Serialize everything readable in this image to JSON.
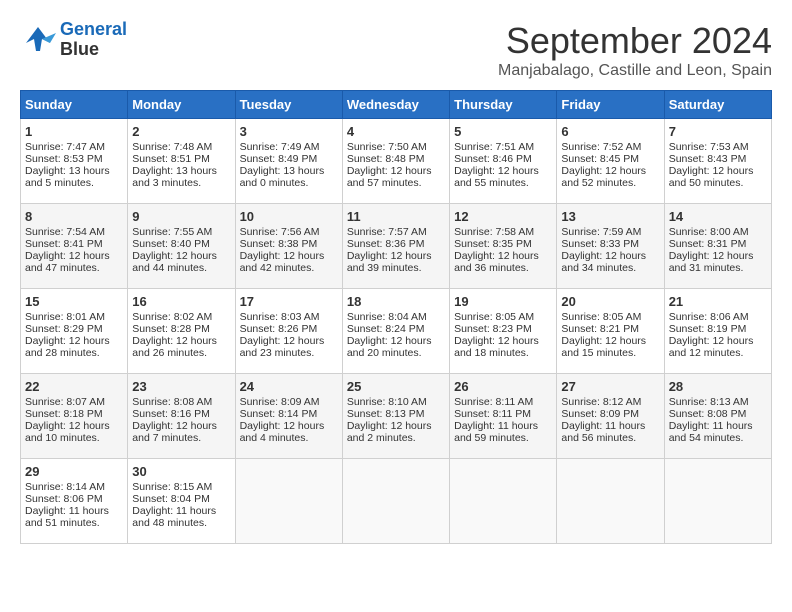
{
  "header": {
    "logo_line1": "General",
    "logo_line2": "Blue",
    "month": "September 2024",
    "location": "Manjabalago, Castille and Leon, Spain"
  },
  "days_of_week": [
    "Sunday",
    "Monday",
    "Tuesday",
    "Wednesday",
    "Thursday",
    "Friday",
    "Saturday"
  ],
  "weeks": [
    [
      {
        "day": "1",
        "sunrise": "7:47 AM",
        "sunset": "8:53 PM",
        "daylight": "13 hours and 5 minutes."
      },
      {
        "day": "2",
        "sunrise": "7:48 AM",
        "sunset": "8:51 PM",
        "daylight": "13 hours and 3 minutes."
      },
      {
        "day": "3",
        "sunrise": "7:49 AM",
        "sunset": "8:49 PM",
        "daylight": "13 hours and 0 minutes."
      },
      {
        "day": "4",
        "sunrise": "7:50 AM",
        "sunset": "8:48 PM",
        "daylight": "12 hours and 57 minutes."
      },
      {
        "day": "5",
        "sunrise": "7:51 AM",
        "sunset": "8:46 PM",
        "daylight": "12 hours and 55 minutes."
      },
      {
        "day": "6",
        "sunrise": "7:52 AM",
        "sunset": "8:45 PM",
        "daylight": "12 hours and 52 minutes."
      },
      {
        "day": "7",
        "sunrise": "7:53 AM",
        "sunset": "8:43 PM",
        "daylight": "12 hours and 50 minutes."
      }
    ],
    [
      {
        "day": "8",
        "sunrise": "7:54 AM",
        "sunset": "8:41 PM",
        "daylight": "12 hours and 47 minutes."
      },
      {
        "day": "9",
        "sunrise": "7:55 AM",
        "sunset": "8:40 PM",
        "daylight": "12 hours and 44 minutes."
      },
      {
        "day": "10",
        "sunrise": "7:56 AM",
        "sunset": "8:38 PM",
        "daylight": "12 hours and 42 minutes."
      },
      {
        "day": "11",
        "sunrise": "7:57 AM",
        "sunset": "8:36 PM",
        "daylight": "12 hours and 39 minutes."
      },
      {
        "day": "12",
        "sunrise": "7:58 AM",
        "sunset": "8:35 PM",
        "daylight": "12 hours and 36 minutes."
      },
      {
        "day": "13",
        "sunrise": "7:59 AM",
        "sunset": "8:33 PM",
        "daylight": "12 hours and 34 minutes."
      },
      {
        "day": "14",
        "sunrise": "8:00 AM",
        "sunset": "8:31 PM",
        "daylight": "12 hours and 31 minutes."
      }
    ],
    [
      {
        "day": "15",
        "sunrise": "8:01 AM",
        "sunset": "8:29 PM",
        "daylight": "12 hours and 28 minutes."
      },
      {
        "day": "16",
        "sunrise": "8:02 AM",
        "sunset": "8:28 PM",
        "daylight": "12 hours and 26 minutes."
      },
      {
        "day": "17",
        "sunrise": "8:03 AM",
        "sunset": "8:26 PM",
        "daylight": "12 hours and 23 minutes."
      },
      {
        "day": "18",
        "sunrise": "8:04 AM",
        "sunset": "8:24 PM",
        "daylight": "12 hours and 20 minutes."
      },
      {
        "day": "19",
        "sunrise": "8:05 AM",
        "sunset": "8:23 PM",
        "daylight": "12 hours and 18 minutes."
      },
      {
        "day": "20",
        "sunrise": "8:05 AM",
        "sunset": "8:21 PM",
        "daylight": "12 hours and 15 minutes."
      },
      {
        "day": "21",
        "sunrise": "8:06 AM",
        "sunset": "8:19 PM",
        "daylight": "12 hours and 12 minutes."
      }
    ],
    [
      {
        "day": "22",
        "sunrise": "8:07 AM",
        "sunset": "8:18 PM",
        "daylight": "12 hours and 10 minutes."
      },
      {
        "day": "23",
        "sunrise": "8:08 AM",
        "sunset": "8:16 PM",
        "daylight": "12 hours and 7 minutes."
      },
      {
        "day": "24",
        "sunrise": "8:09 AM",
        "sunset": "8:14 PM",
        "daylight": "12 hours and 4 minutes."
      },
      {
        "day": "25",
        "sunrise": "8:10 AM",
        "sunset": "8:13 PM",
        "daylight": "12 hours and 2 minutes."
      },
      {
        "day": "26",
        "sunrise": "8:11 AM",
        "sunset": "8:11 PM",
        "daylight": "11 hours and 59 minutes."
      },
      {
        "day": "27",
        "sunrise": "8:12 AM",
        "sunset": "8:09 PM",
        "daylight": "11 hours and 56 minutes."
      },
      {
        "day": "28",
        "sunrise": "8:13 AM",
        "sunset": "8:08 PM",
        "daylight": "11 hours and 54 minutes."
      }
    ],
    [
      {
        "day": "29",
        "sunrise": "8:14 AM",
        "sunset": "8:06 PM",
        "daylight": "11 hours and 51 minutes."
      },
      {
        "day": "30",
        "sunrise": "8:15 AM",
        "sunset": "8:04 PM",
        "daylight": "11 hours and 48 minutes."
      },
      null,
      null,
      null,
      null,
      null
    ]
  ]
}
